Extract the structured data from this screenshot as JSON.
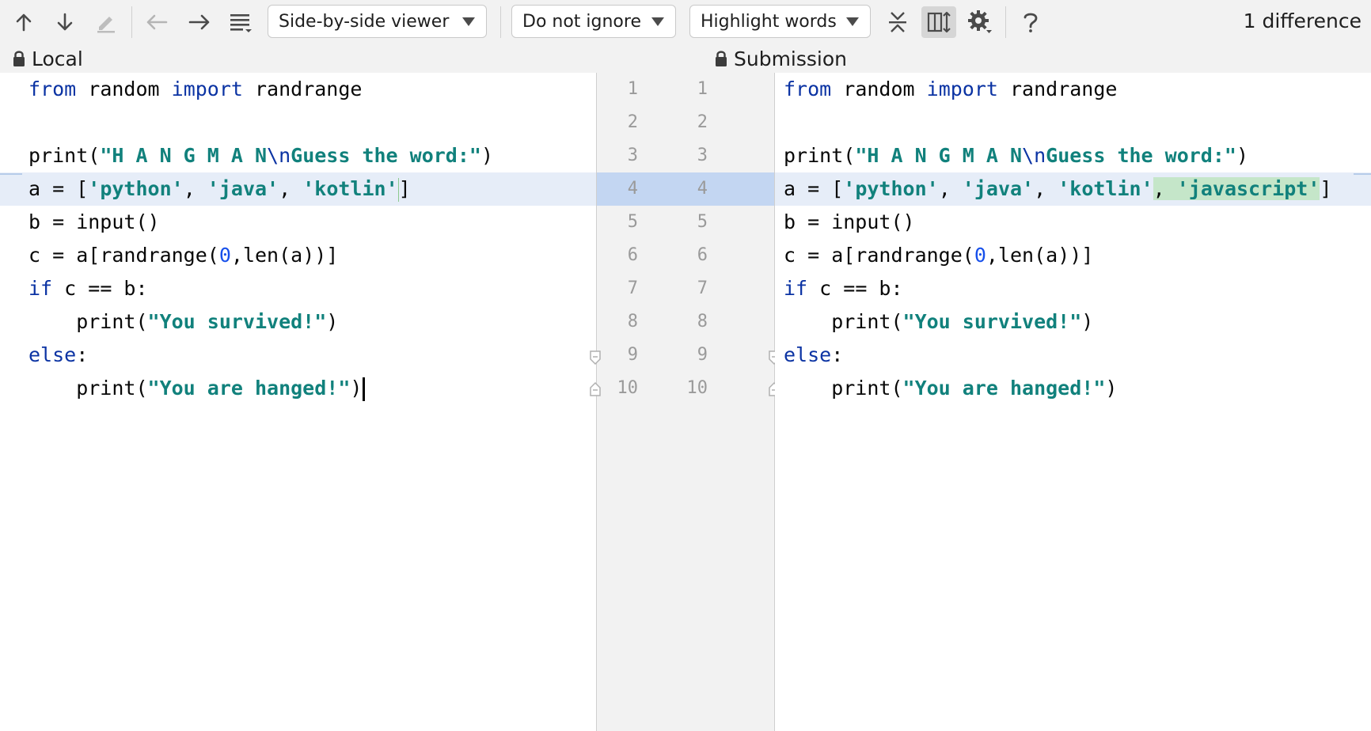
{
  "toolbar": {
    "viewer_select": "Side-by-side viewer",
    "ignore_select": "Do not ignore",
    "highlight_select": "Highlight words",
    "difference_count": "1 difference"
  },
  "icons": [
    "arrow-up-icon",
    "arrow-down-icon",
    "edit-icon",
    "arrow-left-icon",
    "arrow-right-icon",
    "list-icon",
    "collapse-icon",
    "sync-scroll-icon",
    "gear-icon",
    "help-icon",
    "lock-icon"
  ],
  "colors": {
    "changed_line": "#e6edf8",
    "changed_gutter": "#c3d6f2",
    "inserted_text": "#c5e6c9",
    "keyword": "#0b33a3",
    "string": "#11817c"
  },
  "left": {
    "title": "Local",
    "lines": [
      {
        "segs": [
          {
            "t": "from",
            "c": "kw"
          },
          {
            "t": " random "
          },
          {
            "t": "import",
            "c": "kw"
          },
          {
            "t": " randrange"
          }
        ]
      },
      {
        "segs": []
      },
      {
        "segs": [
          {
            "t": "print("
          },
          {
            "t": "\"H A N G M A N",
            "c": "str"
          },
          {
            "t": "\\n",
            "c": "esc"
          },
          {
            "t": "Guess the word:\"",
            "c": "str"
          },
          {
            "t": ")"
          }
        ]
      },
      {
        "changed": true,
        "segs": [
          {
            "t": "a = ["
          },
          {
            "t": "'python'",
            "c": "str"
          },
          {
            "t": ", "
          },
          {
            "t": "'java'",
            "c": "str"
          },
          {
            "t": ", "
          },
          {
            "t": "'kotlin'",
            "c": "str"
          },
          {
            "t": "",
            "c": "lcaret"
          },
          {
            "t": "]"
          }
        ]
      },
      {
        "segs": [
          {
            "t": "b = input()"
          }
        ]
      },
      {
        "segs": [
          {
            "t": "c = a[randrange("
          },
          {
            "t": "0",
            "c": "num"
          },
          {
            "t": ",len(a))]"
          }
        ]
      },
      {
        "segs": [
          {
            "t": "if",
            "c": "kw"
          },
          {
            "t": " c == b:"
          }
        ]
      },
      {
        "segs": [
          {
            "t": "    print("
          },
          {
            "t": "\"You survived!\"",
            "c": "str"
          },
          {
            "t": ")"
          }
        ]
      },
      {
        "segs": [
          {
            "t": "else",
            "c": "kw"
          },
          {
            "t": ":"
          }
        ]
      },
      {
        "segs": [
          {
            "t": "    print("
          },
          {
            "t": "\"You are hanged!\"",
            "c": "str"
          },
          {
            "t": ")"
          },
          {
            "t": "",
            "c": "caret-bar"
          }
        ]
      }
    ]
  },
  "right": {
    "title": "Submission",
    "lines": [
      {
        "segs": [
          {
            "t": "from",
            "c": "kw"
          },
          {
            "t": " random "
          },
          {
            "t": "import",
            "c": "kw"
          },
          {
            "t": " randrange"
          }
        ]
      },
      {
        "segs": []
      },
      {
        "segs": [
          {
            "t": "print("
          },
          {
            "t": "\"H A N G M A N",
            "c": "str"
          },
          {
            "t": "\\n",
            "c": "esc"
          },
          {
            "t": "Guess the word:\"",
            "c": "str"
          },
          {
            "t": ")"
          }
        ]
      },
      {
        "changed": true,
        "segs": [
          {
            "t": "a = ["
          },
          {
            "t": "'python'",
            "c": "str"
          },
          {
            "t": ", "
          },
          {
            "t": "'java'",
            "c": "str"
          },
          {
            "t": ", "
          },
          {
            "t": "'kotlin'",
            "c": "str"
          },
          {
            "t": ", ",
            "c": "ins"
          },
          {
            "t": "'javascript'",
            "c": "str ins"
          },
          {
            "t": "]"
          }
        ]
      },
      {
        "segs": [
          {
            "t": "b = input()"
          }
        ]
      },
      {
        "segs": [
          {
            "t": "c = a[randrange("
          },
          {
            "t": "0",
            "c": "num"
          },
          {
            "t": ",len(a))]"
          }
        ]
      },
      {
        "segs": [
          {
            "t": "if",
            "c": "kw"
          },
          {
            "t": " c == b:"
          }
        ]
      },
      {
        "segs": [
          {
            "t": "    print("
          },
          {
            "t": "\"You survived!\"",
            "c": "str"
          },
          {
            "t": ")"
          }
        ]
      },
      {
        "segs": [
          {
            "t": "else",
            "c": "kw"
          },
          {
            "t": ":"
          }
        ]
      },
      {
        "segs": [
          {
            "t": "    print("
          },
          {
            "t": "\"You are hanged!\"",
            "c": "str"
          },
          {
            "t": ")"
          }
        ]
      }
    ]
  },
  "gutter": {
    "left_numbers": [
      "1",
      "2",
      "3",
      "4",
      "5",
      "6",
      "7",
      "8",
      "9",
      "10"
    ],
    "right_numbers": [
      "1",
      "2",
      "3",
      "4",
      "5",
      "6",
      "7",
      "8",
      "9",
      "10"
    ],
    "changed_line": 4
  }
}
